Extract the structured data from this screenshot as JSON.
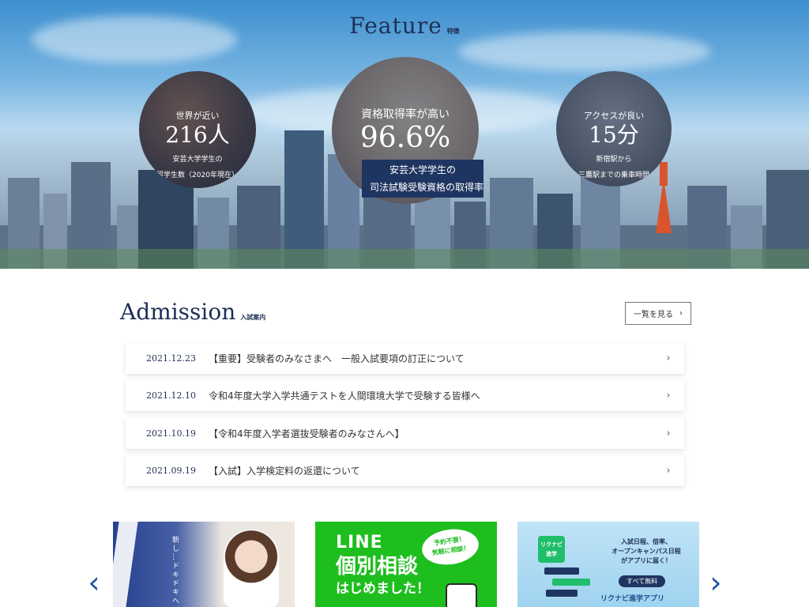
{
  "feature": {
    "title_en": "Feature",
    "title_ja": "特徴",
    "stats": [
      {
        "lead": "世界が近い",
        "value": "216人",
        "sub1": "安芸大学学生の",
        "sub2": "留学生数（2020年現在）"
      },
      {
        "lead": "資格取得率が高い",
        "value": "96.6%",
        "sub1": "安芸大学学生の",
        "sub2": "司法試験受験資格の取得率"
      },
      {
        "lead": "アクセスが良い",
        "value": "15分",
        "sub1": "新宿駅から",
        "sub2": "三鷹駅までの乗車時間"
      }
    ]
  },
  "admission": {
    "title_en": "Admission",
    "title_ja": "入試案内",
    "list_button": "一覧を見る",
    "arrow": "›",
    "news": [
      {
        "date": "2021.12.23",
        "title": "【重要】受験者のみなさまへ　一般入試要項の訂正について"
      },
      {
        "date": "2021.12.10",
        "title": "令和4年度大学入学共通テストを人間環境大学で受験する皆様へ"
      },
      {
        "date": "2021.10.19",
        "title": "【令和4年度入学者選抜受験者のみなさんへ】"
      },
      {
        "date": "2021.09.19",
        "title": "【入試】入学検定料の返還について"
      }
    ]
  },
  "banners": {
    "b1_text": "新し…ドキドキへ",
    "b2_line1": "LINE",
    "b2_line2": "個別相談",
    "b2_line3": "はじめました！",
    "b2_bubble1": "予約不要！",
    "b2_bubble2": "気軽に相談！",
    "b3_logo1": "リクナビ",
    "b3_logo2": "進学",
    "b3_info1": "入試日程、倍率、",
    "b3_info2": "オープンキャンパス日程",
    "b3_info3": "がアプリに届く！",
    "b3_pill": "すべて無料",
    "b3_app": "リクナビ進学アプリ"
  },
  "carousel": {
    "prev": "‹",
    "next": "›"
  },
  "colors": {
    "navy": "#1e2f55",
    "line_green": "#1fbe1f",
    "accent_blue": "#1f56a3"
  }
}
